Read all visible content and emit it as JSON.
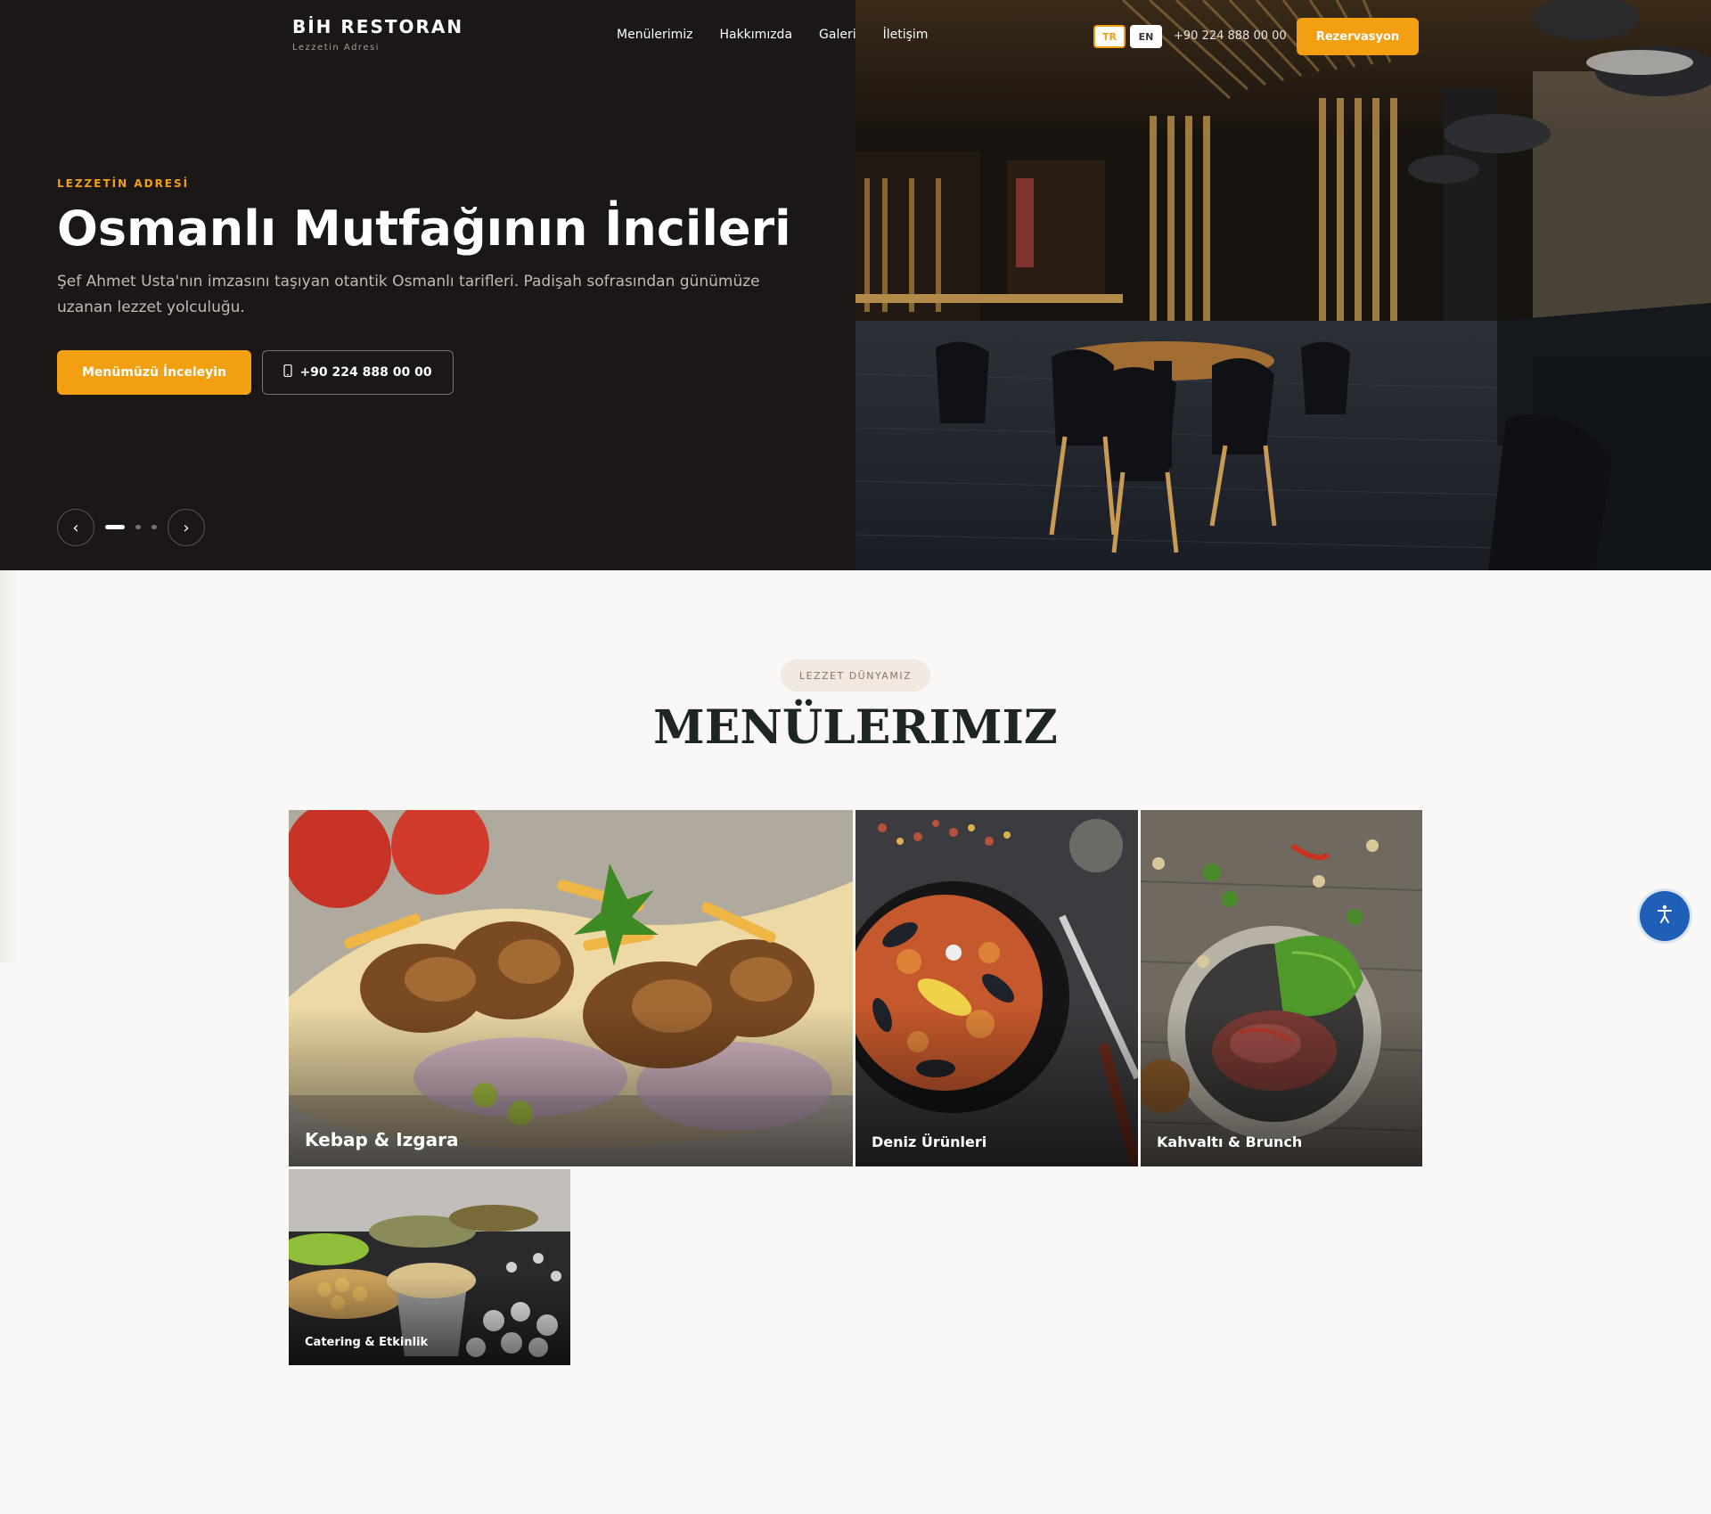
{
  "header": {
    "brand_name": "BİH RESTORAN",
    "brand_tagline": "Lezzetin Adresi",
    "nav": [
      "Menülerimiz",
      "Hakkımızda",
      "Galeri",
      "İletişim"
    ],
    "lang_tr": "TR",
    "lang_en": "EN",
    "phone": "+90 224 888 00 00",
    "reserve_label": "Rezervasyon"
  },
  "hero": {
    "eyebrow": "LEZZETİN ADRESİ",
    "title": "Osmanlı Mutfağının İncileri",
    "description": "Şef Ahmet Usta'nın imzasını taşıyan otantik Osmanlı tarifleri. Padişah sofrasından günümüze uzanan lezzet yolculuğu.",
    "primary_button": "Menümüzü İnceleyin",
    "call_button": "+90 224 888 00 00",
    "prev_arrow": "‹",
    "next_arrow": "›",
    "slides_total": 3,
    "active_slide": 1
  },
  "menus": {
    "badge": "LEZZET DÜNYAMIZ",
    "title": "MENÜLERIMIZ",
    "cards": [
      {
        "label": "Kebap & Izgara"
      },
      {
        "label": "Deniz Ürünleri"
      },
      {
        "label": "Kahvaltı & Brunch"
      },
      {
        "label": "Catering & Etkinlik"
      }
    ]
  },
  "icons": {
    "phone": "phone-icon",
    "accessibility": "accessibility-icon"
  },
  "colors": {
    "accent": "#f29f12",
    "hero_bg": "#1b1716",
    "page_bg": "#f9f8f6",
    "accessibility_button": "#1f5fb8"
  }
}
